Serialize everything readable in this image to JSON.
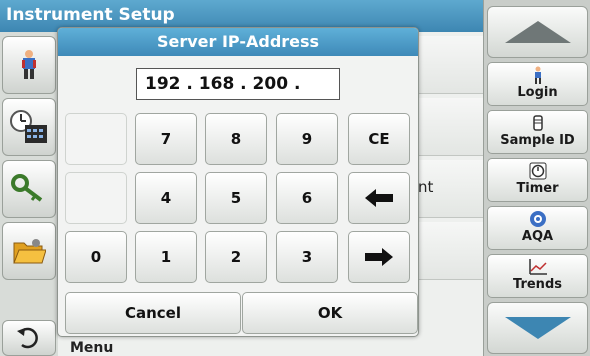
{
  "screen": {
    "title": "Instrument Setup",
    "row_text_partial": "nt",
    "menu_text": "Menu"
  },
  "dialog": {
    "title": "Server IP-Address",
    "ip_value": "192 . 168 . 200 .",
    "keys": {
      "seven": "7",
      "eight": "8",
      "nine": "9",
      "ce": "CE",
      "four": "4",
      "five": "5",
      "six": "6",
      "zero": "0",
      "one": "1",
      "two": "2",
      "three": "3"
    },
    "cancel_label": "Cancel",
    "ok_label": "OK"
  },
  "sidebar": {
    "login": "Login",
    "sample_id": "Sample ID",
    "timer": "Timer",
    "aqa": "AQA",
    "trends": "Trends"
  },
  "colors": {
    "title_blue": "#3e89b8",
    "panel_gray": "#c9cdc9"
  },
  "icons": {
    "left_column": [
      "operator-icon",
      "clock-calendar-icon",
      "key-icon",
      "folder-icon",
      "back-icon"
    ],
    "sidebar": [
      "login-icon",
      "sample-id-icon",
      "timer-icon",
      "aqa-icon",
      "trends-icon"
    ],
    "arrows": [
      "arrow-up-icon",
      "arrow-down-icon",
      "arrow-left-icon",
      "arrow-right-icon"
    ]
  }
}
